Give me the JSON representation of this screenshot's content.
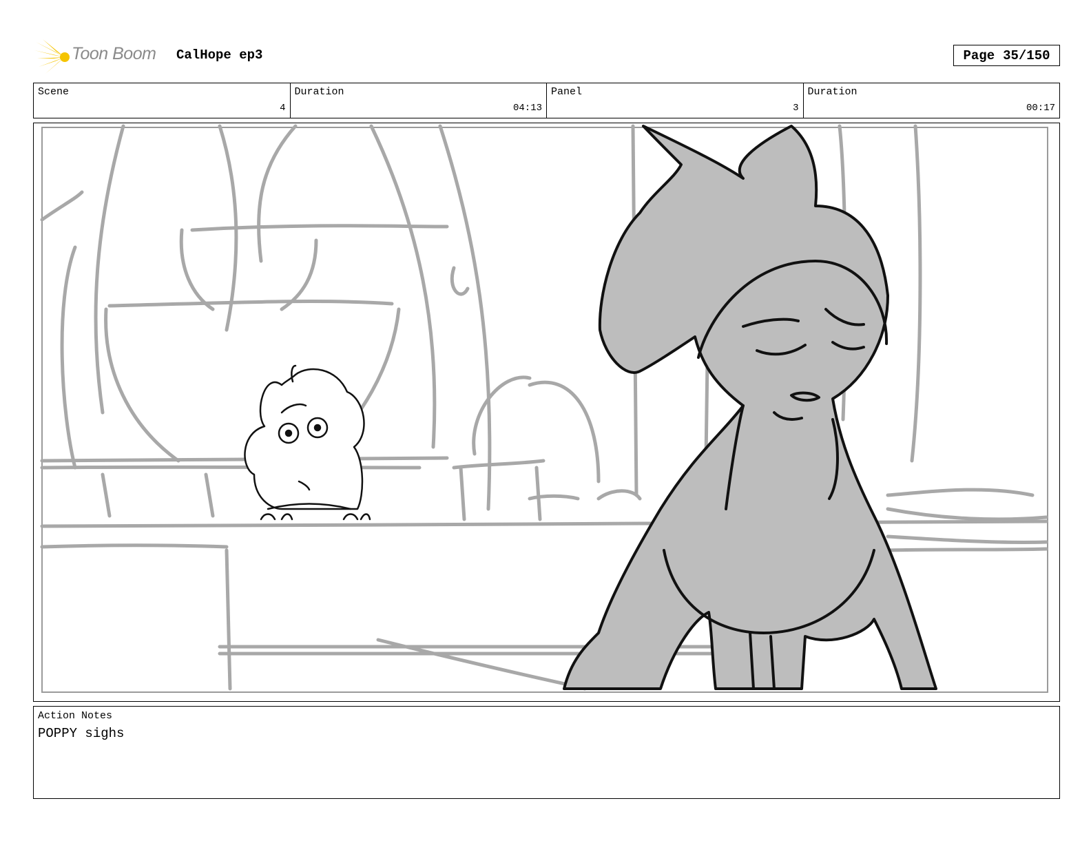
{
  "header": {
    "logo_text": "Toon Boom",
    "project_title": "CalHope ep3",
    "page_label": "Page",
    "page_value": "35/150"
  },
  "info": {
    "scene_label": "Scene",
    "scene_value": "4",
    "scene_duration_label": "Duration",
    "scene_duration_value": "04:13",
    "panel_label": "Panel",
    "panel_value": "3",
    "panel_duration_label": "Duration",
    "panel_duration_value": "00:17"
  },
  "notes": {
    "label": "Action Notes",
    "text": "POPPY sighs"
  },
  "colors": {
    "logo_yellow": "#f5c400",
    "logo_text": "#8a8a8a",
    "sketch_gray": "#a8a8a8",
    "character_fill": "#bdbdbd"
  }
}
